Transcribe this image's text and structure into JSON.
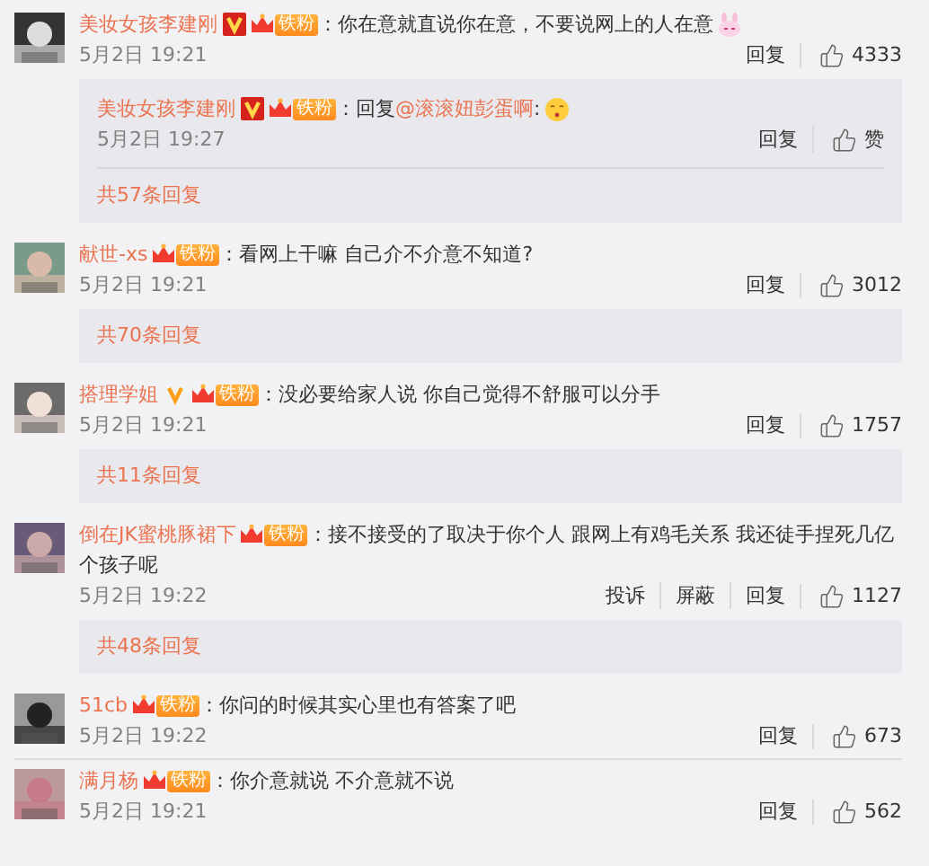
{
  "comments": [
    {
      "name": "美妆女孩李建刚",
      "verified_badge": {
        "kind": "red"
      },
      "fan_badge": "铁粉",
      "separator": "：",
      "text": "你在意就直说你在意，不要说网上的人在意",
      "emoji": {
        "kind": "rabbit"
      },
      "time": "5月2日 19:21",
      "actions": [
        "回复"
      ],
      "likes": "4333",
      "divider": false,
      "reply": {
        "name": "美妆女孩李建刚",
        "verified_badge": {
          "kind": "red"
        },
        "fan_badge": "铁粉",
        "separator": "：",
        "prefix": "回复",
        "mention": "@滚滚妞彭蛋啊",
        "suffix": ":",
        "emoji": {
          "kind": "kiss"
        },
        "time": "5月2日 19:27",
        "actions": [
          "回复"
        ],
        "likes": "赞"
      },
      "more": "共57条回复"
    },
    {
      "name": "献世-xs",
      "fan_badge": "铁粉",
      "separator": "：",
      "text": "看网上干嘛 自己介不介意不知道?",
      "time": "5月2日 19:21",
      "actions": [
        "回复"
      ],
      "likes": "3012",
      "divider": false,
      "more": "共70条回复"
    },
    {
      "name": "搭理学姐",
      "verified_badge": {
        "kind": "orange"
      },
      "fan_badge": "铁粉",
      "separator": "：",
      "text": "没必要给家人说 你自己觉得不舒服可以分手",
      "time": "5月2日 19:21",
      "actions": [
        "回复"
      ],
      "likes": "1757",
      "divider": false,
      "more": "共11条回复"
    },
    {
      "name": "倒在JK蜜桃豚裙下",
      "fan_badge": "铁粉",
      "separator": "：",
      "text": "接不接受的了取决于你个人 跟网上有鸡毛关系 我还徒手捏死几亿个孩子呢",
      "time": "5月2日 19:22",
      "actions": [
        "投诉",
        "屏蔽",
        "回复"
      ],
      "likes": "1127",
      "divider": false,
      "more": "共48条回复"
    },
    {
      "name": "51cb",
      "fan_badge": "铁粉",
      "separator": "：",
      "text": "你问的时候其实心里也有答案了吧",
      "time": "5月2日 19:22",
      "actions": [
        "回复"
      ],
      "likes": "673",
      "divider": true
    },
    {
      "name": "满月杨",
      "fan_badge": "铁粉",
      "separator": "：",
      "text": "你介意就说 不介意就不说",
      "time": "5月2日 19:21",
      "actions": [
        "回复"
      ],
      "likes": "562",
      "divider": false
    }
  ]
}
